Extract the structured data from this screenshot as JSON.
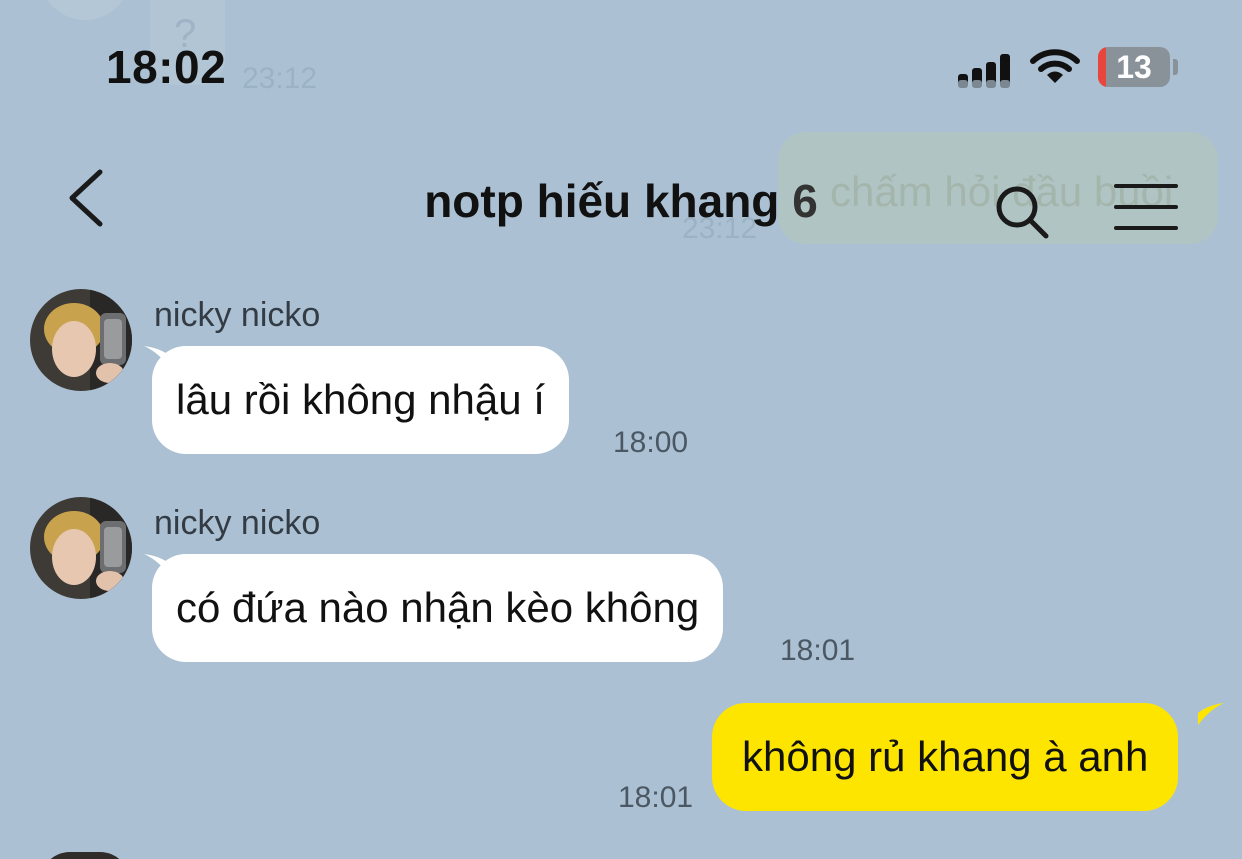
{
  "status_bar": {
    "time": "18:02",
    "battery_level": "13",
    "signal_bars": 4,
    "wifi_icon": "wifi-icon"
  },
  "header": {
    "title": "notp hiếu khang",
    "member_count": "6",
    "back_icon": "chevron-left-icon",
    "search_icon": "search-icon",
    "menu_icon": "hamburger-menu-icon"
  },
  "ghost": {
    "left_mark": "?",
    "time_top": "23:12",
    "right_text": "chấm hỏi đầu buồi",
    "time_mid": "23:12"
  },
  "messages": [
    {
      "sender": "nicky nicko",
      "text": "lâu rồi không nhậu í",
      "time": "18:00",
      "direction": "incoming"
    },
    {
      "sender": "nicky nicko",
      "text": "có đứa nào nhận kèo không",
      "time": "18:01",
      "direction": "incoming"
    },
    {
      "sender": "",
      "text": "không rủ khang à anh",
      "time": "18:01",
      "direction": "outgoing"
    }
  ],
  "colors": {
    "background": "#abc1d3",
    "incoming_bubble": "#ffffff",
    "outgoing_bubble": "#fee500",
    "battery_low": "#e8453c"
  }
}
